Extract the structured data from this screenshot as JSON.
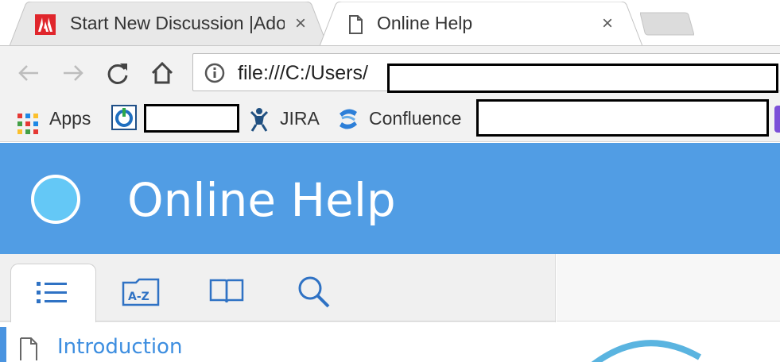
{
  "tabs": [
    {
      "title": "Start New Discussion |Adobe",
      "close": "×",
      "favicon": "adobe-icon"
    },
    {
      "title": "Online Help",
      "close": "×",
      "favicon": "document-icon"
    }
  ],
  "toolbar": {
    "url": "file:///C:/Users/"
  },
  "bookmarks": {
    "apps_label": "Apps",
    "jira_label": "JIRA",
    "confluence_label": "Confluence"
  },
  "app": {
    "title": "Online Help",
    "accent": "#519de4",
    "logo_color": "#64c8f6"
  },
  "sidebar": {
    "tabs": [
      "contents-icon",
      "index-icon",
      "glossary-icon",
      "search-icon"
    ],
    "items": [
      {
        "label": "Introduction"
      }
    ]
  }
}
